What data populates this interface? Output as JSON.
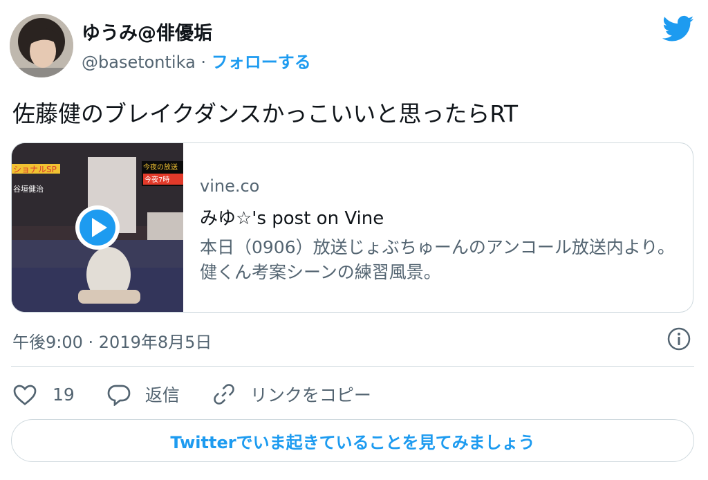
{
  "author": {
    "display_name": "ゆうみ@俳優垢",
    "handle": "@basetontika",
    "separator": "·",
    "follow_label": "フォローする"
  },
  "tweet": {
    "text": "佐藤健のブレイクダンスかっこいいと思ったらRT",
    "timestamp": "午後9:00 · 2019年8月5日"
  },
  "card": {
    "domain": "vine.co",
    "title": "みゆ☆'s post on Vine",
    "description": "本日（0906）放送じょぶちゅーんのアンコール放送内より。健くん考案シーンの練習風景。",
    "overlay_texts": {
      "left_banner": "ショナルSP",
      "left_caption": "谷垣健治",
      "right_banner_top": "今夜の放送",
      "right_banner_bottom": "今夜7時"
    }
  },
  "actions": {
    "like_count": "19",
    "reply_label": "返信",
    "copy_link_label": "リンクをコピー"
  },
  "cta": {
    "label": "Twitterでいま起きていることを見てみましょう"
  },
  "colors": {
    "accent": "#1d9bf0",
    "secondary_text": "#536471",
    "border": "#cfd9de"
  },
  "icons": [
    "twitter-bird-icon",
    "play-icon",
    "info-icon",
    "heart-icon",
    "reply-icon",
    "link-icon"
  ]
}
